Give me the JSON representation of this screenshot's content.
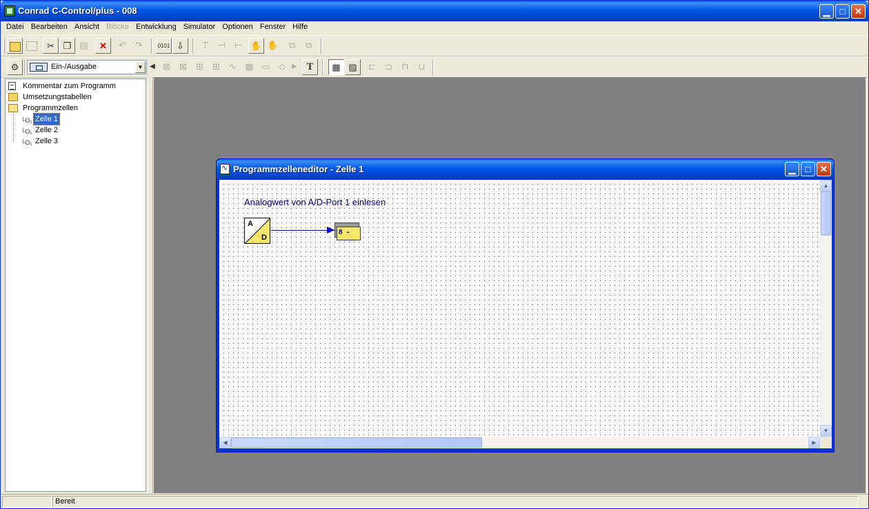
{
  "app": {
    "title": "Conrad C-Control/plus - 008"
  },
  "menu": {
    "items": [
      {
        "label": "Datei",
        "enabled": true
      },
      {
        "label": "Bearbeiten",
        "enabled": true
      },
      {
        "label": "Ansicht",
        "enabled": true
      },
      {
        "label": "Blöcke",
        "enabled": false
      },
      {
        "label": "Entwicklung",
        "enabled": true
      },
      {
        "label": "Simulator",
        "enabled": true
      },
      {
        "label": "Optionen",
        "enabled": true
      },
      {
        "label": "Fenster",
        "enabled": true
      },
      {
        "label": "Hilfe",
        "enabled": true
      }
    ]
  },
  "toolbar": {
    "block_category": "Ein-/Ausgabe",
    "text_tool_glyph": "T"
  },
  "tree": {
    "items": [
      {
        "label": "Kommentar zum Programm",
        "icon": "document-icon"
      },
      {
        "label": "Umsetzungstabellen",
        "icon": "folder-icon"
      },
      {
        "label": "Programmzellen",
        "icon": "folder-open-icon"
      },
      {
        "label": "Zelle 1",
        "icon": "program-cell-icon",
        "selected": true
      },
      {
        "label": "Zelle 2",
        "icon": "program-cell-icon",
        "selected": false
      },
      {
        "label": "Zelle 3",
        "icon": "program-cell-icon",
        "selected": false
      }
    ]
  },
  "editor": {
    "title": "Programmzelleneditor - Zelle 1",
    "comment": "Analogwert von A/D-Port 1 einlesen",
    "ad_block": {
      "input_label": "A",
      "output_label": "D"
    },
    "port_block": {
      "number": "8",
      "sign": "-"
    }
  },
  "status": {
    "text": "Bereit"
  },
  "colors": {
    "titlebar": "#0058e6",
    "mdi_background": "#808080",
    "comment_text": "#000080",
    "block_yellow": "#f6e76a",
    "selection": "#316ac5"
  }
}
